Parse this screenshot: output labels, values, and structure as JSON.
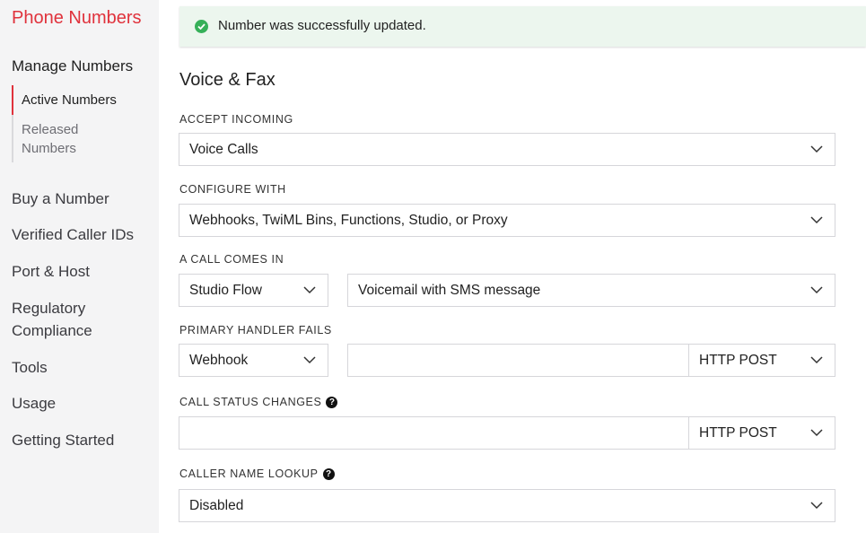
{
  "sidebar": {
    "title": "Phone Numbers",
    "section": "Manage Numbers",
    "sub_items": [
      {
        "label": "Active Numbers"
      },
      {
        "label": "Released Numbers"
      }
    ],
    "links": [
      {
        "label": "Buy a Number"
      },
      {
        "label": "Verified Caller IDs"
      },
      {
        "label": "Port & Host"
      },
      {
        "label": "Regulatory Compliance"
      },
      {
        "label": "Tools"
      },
      {
        "label": "Usage"
      },
      {
        "label": "Getting Started"
      }
    ],
    "accent_color": "#e0323c"
  },
  "alert": {
    "message": "Number was successfully updated.",
    "icon": "check-circle-icon",
    "color": "#36b059"
  },
  "main": {
    "heading": "Voice & Fax",
    "accept_incoming": {
      "label": "ACCEPT INCOMING",
      "value": "Voice Calls"
    },
    "configure_with": {
      "label": "CONFIGURE WITH",
      "value": "Webhooks, TwiML Bins, Functions, Studio, or Proxy"
    },
    "call_comes_in": {
      "label": "A CALL COMES IN",
      "type": "Studio Flow",
      "value": "Voicemail with SMS message"
    },
    "primary_handler_fails": {
      "label": "PRIMARY HANDLER FAILS",
      "type": "Webhook",
      "url": "",
      "method": "HTTP POST"
    },
    "call_status_changes": {
      "label": "CALL STATUS CHANGES",
      "url": "",
      "method": "HTTP POST"
    },
    "caller_name_lookup": {
      "label": "CALLER NAME LOOKUP",
      "value": "Disabled"
    }
  }
}
